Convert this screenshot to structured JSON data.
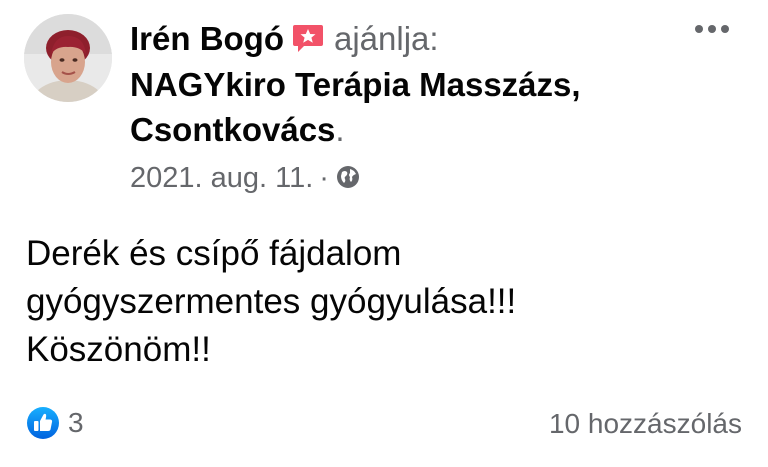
{
  "post": {
    "author": "Irén Bogó",
    "recommends": "ajánlja:",
    "page_line1": "NAGYkiro Terápia Masszázs,",
    "page_line2": "Csontkovács",
    "page_period": ".",
    "date": "2021. aug. 11.",
    "separator": "·",
    "privacy_icon": "globe-icon",
    "text_lines": [
      "Derék és csípő fájdalom",
      "gyógyszermentes gyógyulása!!!",
      "Köszönöm!!"
    ]
  },
  "footer": {
    "reaction_icon": "like-icon",
    "reaction_count": "3",
    "comments": "10 hozzászólás"
  },
  "colors": {
    "secondary_text": "#65676b",
    "like_blue": "#1877f2",
    "badge_red": "#f25268"
  }
}
